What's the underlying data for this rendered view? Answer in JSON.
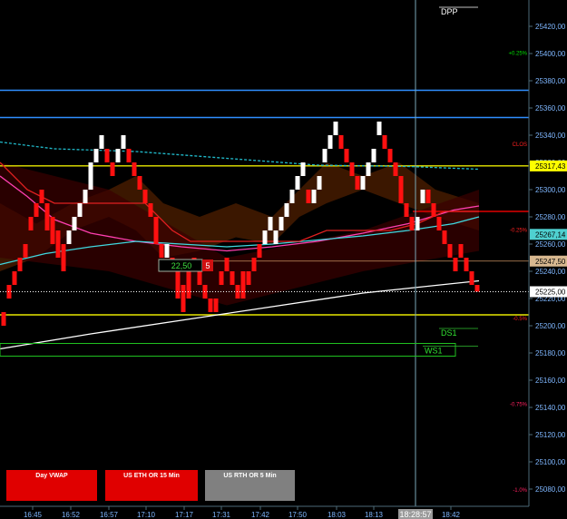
{
  "chart_data": {
    "type": "candlestick-renko",
    "title": "",
    "xlabel": "",
    "ylabel": "",
    "ylim": [
      25067,
      25437
    ],
    "y_ticks": [
      25420,
      25400,
      25380,
      25360,
      25340,
      25320,
      25300,
      25280,
      25260,
      25240,
      25220,
      25200,
      25180,
      25160,
      25140,
      25120,
      25100,
      25080
    ],
    "y_tick_labels": [
      "25420,00",
      "25400,00",
      "25380,00",
      "25360,00",
      "25340,00",
      "25320,00",
      "25300,00",
      "25280,00",
      "25260,00",
      "25240,00",
      "25220,00",
      "25200,00",
      "25180,00",
      "25160,00",
      "25140,00",
      "25120,00",
      "25100,00",
      "25080,00"
    ],
    "x_labels": [
      "16:45",
      "16:52",
      "16:57",
      "17:10",
      "17:17",
      "17:31",
      "17:42",
      "17:50",
      "18:03",
      "18:13",
      "18:42"
    ],
    "cursor_time": "18:28:57",
    "price_tags": [
      {
        "label": "25317,43",
        "value": 25317.43,
        "color": "#ffff00"
      },
      {
        "label": "25267,14",
        "value": 25267.14,
        "color": "#4fd0d0"
      },
      {
        "label": "25247,50",
        "value": 25247.5,
        "color": "#d8b890"
      },
      {
        "label": "25225,00",
        "value": 25225.0,
        "color": "#ffffff"
      }
    ],
    "horizontal_lines": [
      {
        "value": 25373,
        "color": "#2f8fff"
      },
      {
        "value": 25353,
        "color": "#2f8fff"
      },
      {
        "value": 25317.43,
        "color": "#e8e800"
      },
      {
        "value": 25208,
        "color": "#e8e800"
      },
      {
        "value": 25284,
        "color": "#e00000"
      }
    ],
    "percent_labels": [
      {
        "text": "+0.25%",
        "value": 25401,
        "color": "#00e000"
      },
      {
        "text": "CLOS",
        "value": 25334,
        "color": "#ff2020"
      },
      {
        "text": "-0.25%",
        "value": 25271,
        "color": "#ff2020"
      },
      {
        "text": "-0.5%",
        "value": 25206,
        "color": "#ff2020"
      },
      {
        "text": "-0.75%",
        "value": 25143,
        "color": "#ff2060"
      },
      {
        "text": "-1.0%",
        "value": 25080,
        "color": "#ff2060"
      }
    ],
    "level_labels": [
      {
        "text": "DPP",
        "value": 25432
      },
      {
        "text": "DS1",
        "value": 25196
      },
      {
        "text": "WS1",
        "value": 25183
      }
    ],
    "annotation": {
      "value_text": "22,50",
      "count_text": "5",
      "value": 25244
    },
    "bricks": [
      {
        "x": 4,
        "o": 25210,
        "c": 25200
      },
      {
        "x": 10,
        "o": 25230,
        "c": 25220
      },
      {
        "x": 16,
        "o": 25240,
        "c": 25230
      },
      {
        "x": 22,
        "o": 25250,
        "c": 25240
      },
      {
        "x": 28,
        "o": 25260,
        "c": 25250
      },
      {
        "x": 34,
        "o": 25280,
        "c": 25270
      },
      {
        "x": 40,
        "o": 25290,
        "c": 25280
      },
      {
        "x": 46,
        "o": 25300,
        "c": 25290
      },
      {
        "x": 52,
        "o": 25290,
        "c": 25270
      },
      {
        "x": 58,
        "o": 25280,
        "c": 25260
      },
      {
        "x": 64,
        "o": 25270,
        "c": 25250
      },
      {
        "x": 70,
        "o": 25260,
        "c": 25240
      },
      {
        "x": 76,
        "o": 25260,
        "c": 25270
      },
      {
        "x": 82,
        "o": 25270,
        "c": 25280
      },
      {
        "x": 88,
        "o": 25280,
        "c": 25290
      },
      {
        "x": 94,
        "o": 25290,
        "c": 25300
      },
      {
        "x": 100,
        "o": 25300,
        "c": 25320
      },
      {
        "x": 106,
        "o": 25320,
        "c": 25330
      },
      {
        "x": 112,
        "o": 25330,
        "c": 25340
      },
      {
        "x": 118,
        "o": 25330,
        "c": 25320
      },
      {
        "x": 124,
        "o": 25320,
        "c": 25310
      },
      {
        "x": 130,
        "o": 25320,
        "c": 25330
      },
      {
        "x": 136,
        "o": 25330,
        "c": 25340
      },
      {
        "x": 142,
        "o": 25330,
        "c": 25320
      },
      {
        "x": 148,
        "o": 25320,
        "c": 25310
      },
      {
        "x": 154,
        "o": 25310,
        "c": 25300
      },
      {
        "x": 160,
        "o": 25300,
        "c": 25290
      },
      {
        "x": 166,
        "o": 25290,
        "c": 25280
      },
      {
        "x": 172,
        "o": 25280,
        "c": 25260
      },
      {
        "x": 178,
        "o": 25260,
        "c": 25250
      },
      {
        "x": 184,
        "o": 25250,
        "c": 25260
      },
      {
        "x": 190,
        "o": 25250,
        "c": 25240
      },
      {
        "x": 196,
        "o": 25240,
        "c": 25220
      },
      {
        "x": 202,
        "o": 25230,
        "c": 25210
      },
      {
        "x": 208,
        "o": 25240,
        "c": 25220
      },
      {
        "x": 214,
        "o": 25250,
        "c": 25240
      },
      {
        "x": 220,
        "o": 25240,
        "c": 25230
      },
      {
        "x": 226,
        "o": 25230,
        "c": 25220
      },
      {
        "x": 232,
        "o": 25220,
        "c": 25210
      },
      {
        "x": 238,
        "o": 25220,
        "c": 25210
      },
      {
        "x": 244,
        "o": 25240,
        "c": 25230
      },
      {
        "x": 250,
        "o": 25250,
        "c": 25240
      },
      {
        "x": 256,
        "o": 25240,
        "c": 25230
      },
      {
        "x": 262,
        "o": 25230,
        "c": 25220
      },
      {
        "x": 268,
        "o": 25240,
        "c": 25220
      },
      {
        "x": 274,
        "o": 25240,
        "c": 25230
      },
      {
        "x": 280,
        "o": 25250,
        "c": 25240
      },
      {
        "x": 286,
        "o": 25260,
        "c": 25250
      },
      {
        "x": 292,
        "o": 25260,
        "c": 25270
      },
      {
        "x": 298,
        "o": 25270,
        "c": 25280
      },
      {
        "x": 304,
        "o": 25260,
        "c": 25270
      },
      {
        "x": 310,
        "o": 25270,
        "c": 25280
      },
      {
        "x": 316,
        "o": 25280,
        "c": 25290
      },
      {
        "x": 322,
        "o": 25290,
        "c": 25300
      },
      {
        "x": 328,
        "o": 25300,
        "c": 25310
      },
      {
        "x": 334,
        "o": 25310,
        "c": 25320
      },
      {
        "x": 340,
        "o": 25300,
        "c": 25290
      },
      {
        "x": 346,
        "o": 25290,
        "c": 25300
      },
      {
        "x": 352,
        "o": 25300,
        "c": 25310
      },
      {
        "x": 358,
        "o": 25320,
        "c": 25330
      },
      {
        "x": 364,
        "o": 25330,
        "c": 25340
      },
      {
        "x": 370,
        "o": 25340,
        "c": 25350
      },
      {
        "x": 376,
        "o": 25340,
        "c": 25330
      },
      {
        "x": 382,
        "o": 25330,
        "c": 25320
      },
      {
        "x": 388,
        "o": 25320,
        "c": 25310
      },
      {
        "x": 394,
        "o": 25310,
        "c": 25300
      },
      {
        "x": 400,
        "o": 25300,
        "c": 25310
      },
      {
        "x": 406,
        "o": 25310,
        "c": 25320
      },
      {
        "x": 412,
        "o": 25320,
        "c": 25330
      },
      {
        "x": 418,
        "o": 25340,
        "c": 25350
      },
      {
        "x": 424,
        "o": 25340,
        "c": 25330
      },
      {
        "x": 430,
        "o": 25330,
        "c": 25320
      },
      {
        "x": 436,
        "o": 25320,
        "c": 25310
      },
      {
        "x": 442,
        "o": 25310,
        "c": 25290
      },
      {
        "x": 448,
        "o": 25290,
        "c": 25280
      },
      {
        "x": 454,
        "o": 25280,
        "c": 25270
      },
      {
        "x": 460,
        "o": 25270,
        "c": 25280
      },
      {
        "x": 466,
        "o": 25290,
        "c": 25300
      },
      {
        "x": 472,
        "o": 25300,
        "c": 25290
      },
      {
        "x": 478,
        "o": 25290,
        "c": 25280
      },
      {
        "x": 484,
        "o": 25280,
        "c": 25270
      },
      {
        "x": 490,
        "o": 25270,
        "c": 25260
      },
      {
        "x": 496,
        "o": 25260,
        "c": 25250
      },
      {
        "x": 502,
        "o": 25250,
        "c": 25240
      },
      {
        "x": 508,
        "o": 25260,
        "c": 25250
      },
      {
        "x": 514,
        "o": 25250,
        "c": 25240
      },
      {
        "x": 520,
        "o": 25240,
        "c": 25230
      },
      {
        "x": 526,
        "o": 25230,
        "c": 25225
      }
    ],
    "lines": [
      {
        "name": "",
        "color": "#ff3fb0",
        "points": [
          [
            0,
            25310
          ],
          [
            30,
            25295
          ],
          [
            60,
            25278
          ],
          [
            100,
            25268
          ],
          [
            150,
            25262
          ],
          [
            200,
            25258
          ],
          [
            250,
            25255
          ],
          [
            300,
            25258
          ],
          [
            350,
            25262
          ],
          [
            400,
            25268
          ],
          [
            450,
            25275
          ],
          [
            500,
            25285
          ],
          [
            528,
            25288
          ]
        ]
      },
      {
        "name": "",
        "color": "#40d8e0",
        "points": [
          [
            0,
            25245
          ],
          [
            50,
            25253
          ],
          [
            100,
            25258
          ],
          [
            150,
            25262
          ],
          [
            200,
            25260
          ],
          [
            250,
            25258
          ],
          [
            300,
            25260
          ],
          [
            350,
            25263
          ],
          [
            400,
            25266
          ],
          [
            450,
            25270
          ],
          [
            500,
            25275
          ],
          [
            528,
            25280
          ]
        ]
      },
      {
        "name": "",
        "color": "#e02020",
        "points": [
          [
            0,
            25320
          ],
          [
            30,
            25300
          ],
          [
            60,
            25290
          ],
          [
            120,
            25290
          ],
          [
            160,
            25290
          ],
          [
            190,
            25270
          ],
          [
            210,
            25262
          ],
          [
            260,
            25262
          ],
          [
            300,
            25262
          ],
          [
            330,
            25262
          ],
          [
            360,
            25270
          ],
          [
            430,
            25270
          ],
          [
            460,
            25275
          ],
          [
            490,
            25284
          ],
          [
            528,
            25284
          ]
        ]
      },
      {
        "name": "",
        "color": "#20b8c8",
        "dashed": true,
        "points": [
          [
            0,
            25335
          ],
          [
            60,
            25330
          ],
          [
            150,
            25328
          ],
          [
            250,
            25323
          ],
          [
            350,
            25318
          ],
          [
            450,
            25317
          ],
          [
            528,
            25315
          ]
        ]
      },
      {
        "name": "",
        "color": "#ffffff",
        "points": [
          [
            0,
            25183
          ],
          [
            100,
            25194
          ],
          [
            200,
            25204
          ],
          [
            300,
            25214
          ],
          [
            400,
            25224
          ],
          [
            528,
            25233
          ]
        ]
      }
    ],
    "cloud_upper": [
      [
        0,
        25290
      ],
      [
        40,
        25275
      ],
      [
        80,
        25290
      ],
      [
        120,
        25300
      ],
      [
        150,
        25310
      ],
      [
        180,
        25290
      ],
      [
        220,
        25280
      ],
      [
        260,
        25290
      ],
      [
        300,
        25280
      ],
      [
        330,
        25300
      ],
      [
        360,
        25320
      ],
      [
        400,
        25310
      ],
      [
        440,
        25320
      ],
      [
        480,
        25300
      ],
      [
        528,
        25290
      ]
    ],
    "cloud_lower": [
      [
        0,
        25240
      ],
      [
        40,
        25250
      ],
      [
        80,
        25270
      ],
      [
        120,
        25280
      ],
      [
        150,
        25270
      ],
      [
        180,
        25250
      ],
      [
        220,
        25255
      ],
      [
        260,
        25265
      ],
      [
        300,
        25260
      ],
      [
        330,
        25280
      ],
      [
        360,
        25290
      ],
      [
        400,
        25300
      ],
      [
        440,
        25290
      ],
      [
        480,
        25280
      ],
      [
        528,
        25270
      ]
    ]
  },
  "buttons": [
    {
      "label": "Day VWAP",
      "bg": "#e00000"
    },
    {
      "label": "US ETH OR 15 Min",
      "bg": "#e00000"
    },
    {
      "label": "US RTH OR 5 Min",
      "bg": "#808080"
    }
  ]
}
